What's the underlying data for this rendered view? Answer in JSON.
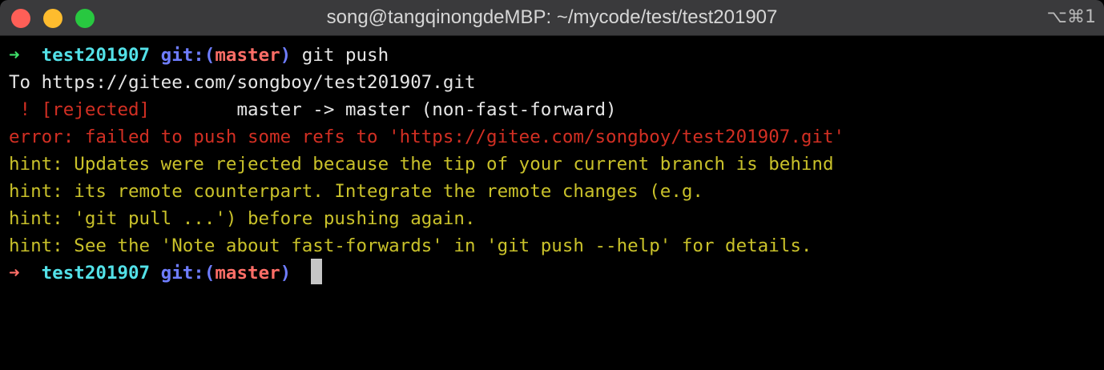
{
  "window": {
    "title": "song@tangqinongdeMBP: ~/mycode/test/test201907",
    "shortcut": "⌥⌘1"
  },
  "prompt1": {
    "arrow": "➜",
    "dir": "test201907",
    "git": "git:(",
    "branch": "master",
    "git_close": ")",
    "command": "git push"
  },
  "output": {
    "to_line": "To https://gitee.com/songboy/test201907.git",
    "rejected_mark": " ! [rejected]",
    "rejected_detail": "        master -> master (non-fast-forward)",
    "error": "error: failed to push some refs to 'https://gitee.com/songboy/test201907.git'",
    "hints": [
      "hint: Updates were rejected because the tip of your current branch is behind",
      "hint: its remote counterpart. Integrate the remote changes (e.g.",
      "hint: 'git pull ...') before pushing again.",
      "hint: See the 'Note about fast-forwards' in 'git push --help' for details."
    ]
  },
  "prompt2": {
    "arrow": "➜",
    "dir": "test201907",
    "git": "git:(",
    "branch": "master",
    "git_close": ")"
  }
}
